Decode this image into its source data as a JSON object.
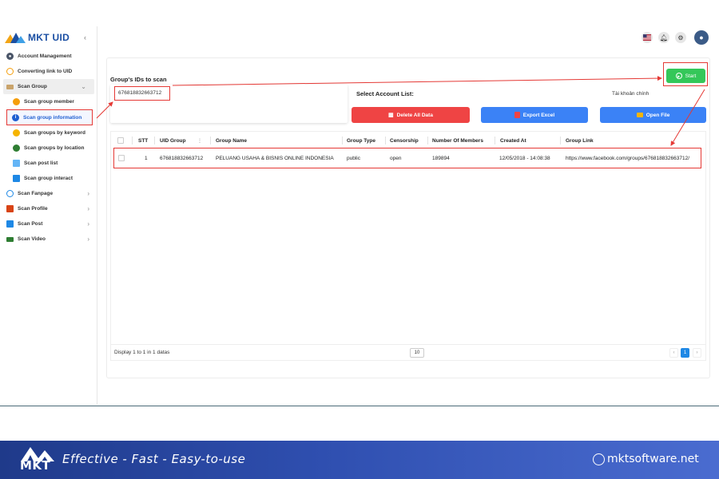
{
  "app": {
    "logo_text": "MKT UID",
    "collapse_icon": "chevron-left-icon"
  },
  "sidebar": {
    "items": [
      {
        "label": "Account Management",
        "icon": "user-circle-icon"
      },
      {
        "label": "Converting link to UID",
        "icon": "refresh-icon"
      },
      {
        "label": "Scan Group",
        "icon": "folder-icon"
      },
      {
        "label": "Scan group member",
        "icon": "users-icon"
      },
      {
        "label": "Scan group information",
        "icon": "info-icon"
      },
      {
        "label": "Scan groups by keyword",
        "icon": "key-icon"
      },
      {
        "label": "Scan groups by location",
        "icon": "globe-icon"
      },
      {
        "label": "Scan post list",
        "icon": "list-icon"
      },
      {
        "label": "Scan group interact",
        "icon": "calendar-icon"
      },
      {
        "label": "Scan Fanpage",
        "icon": "search-icon"
      },
      {
        "label": "Scan Profile",
        "icon": "home-icon"
      },
      {
        "label": "Scan Post",
        "icon": "document-icon"
      },
      {
        "label": "Scan Video",
        "icon": "video-icon"
      }
    ]
  },
  "form": {
    "scan_label": "Group's IDs to scan",
    "group_id_value": "676818832663712",
    "account_label": "Select Account List:",
    "account_selected": "Tài khoản chính",
    "delete_label": "Delete All Data",
    "export_label": "Export Excel",
    "open_label": "Open File",
    "start_label": "Start"
  },
  "table": {
    "headers": [
      "STT",
      "UID Group",
      "Group Name",
      "Group Type",
      "Censorship",
      "Number Of Members",
      "Created At",
      "Group Link"
    ],
    "rows": [
      {
        "stt": "1",
        "uid": "676818832663712",
        "name": "PELUANG USAHA & BISNIS ONLINE INDONESIA",
        "type": "public",
        "censorship": "open",
        "members": "189894",
        "created": "12/05/2018 - 14:08:38",
        "link": "https://www.facebook.com/groups/676818832663712/"
      }
    ]
  },
  "pagination": {
    "display_info": "Display 1 to 1 in 1 datas",
    "page_size": "10",
    "prev": "‹",
    "current": "1",
    "next": "›"
  },
  "banner": {
    "logo_text": "MKT",
    "tagline": "Effective - Fast - Easy-to-use",
    "site": "mktsoftware.net"
  },
  "colors": {
    "accent": "#1e88e5",
    "delete": "#ef4444",
    "primary_button": "#3b82f6",
    "start": "#34c759",
    "highlight": "#e53935"
  }
}
